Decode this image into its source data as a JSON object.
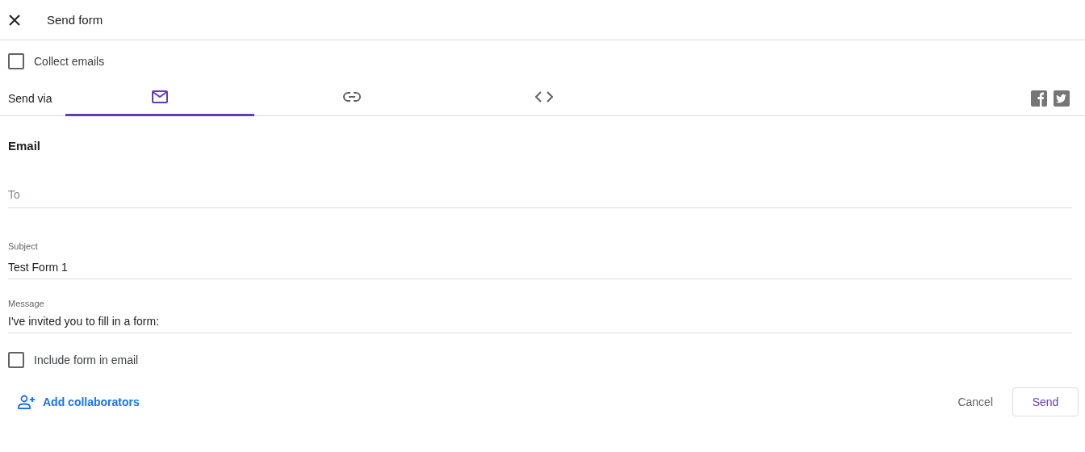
{
  "dialog": {
    "title": "Send form"
  },
  "collect_emails": {
    "label": "Collect emails",
    "checked": false
  },
  "send_via": {
    "label": "Send via",
    "tabs": [
      {
        "kind": "email",
        "selected": true
      },
      {
        "kind": "link",
        "selected": false
      },
      {
        "kind": "embed",
        "selected": false
      }
    ]
  },
  "email": {
    "heading": "Email",
    "to": {
      "placeholder": "To"
    },
    "subject": {
      "label": "Subject",
      "value": "Test Form 1"
    },
    "message": {
      "label": "Message",
      "value": "I've invited you to fill in a form:"
    },
    "include_form": {
      "label": "Include form in email",
      "checked": false
    }
  },
  "footer": {
    "add_collaborators": "Add collaborators",
    "buttons": [
      "Cancel",
      "Send"
    ]
  }
}
